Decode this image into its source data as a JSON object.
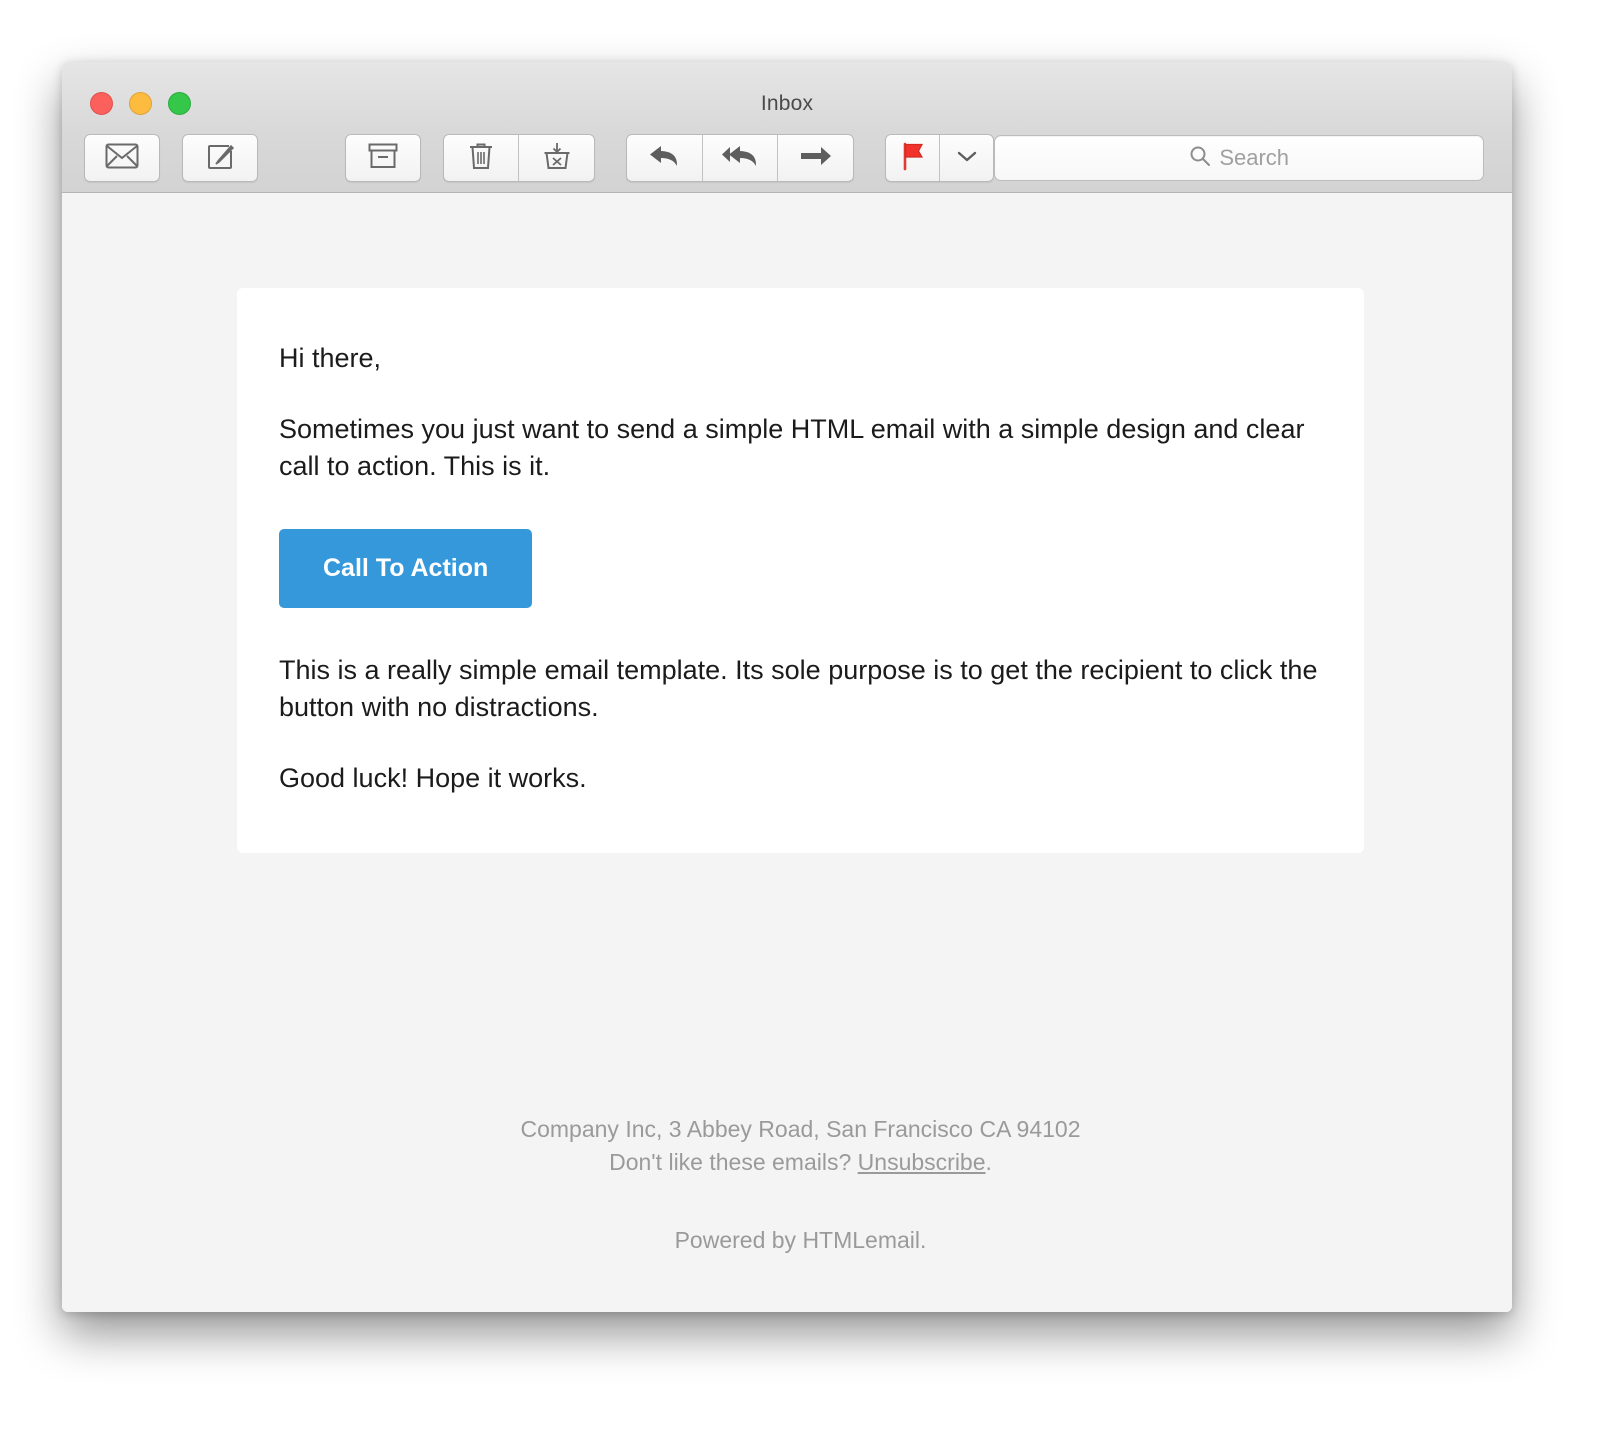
{
  "window": {
    "title": "Inbox",
    "traffic_lights": [
      {
        "name": "close",
        "color": "#fc605c"
      },
      {
        "name": "minimize",
        "color": "#fdbc40"
      },
      {
        "name": "maximize",
        "color": "#34c749"
      }
    ]
  },
  "toolbar": {
    "buttons": [
      {
        "name": "get-mail",
        "icon": "envelope-icon",
        "label": "Get Mail"
      },
      {
        "name": "compose",
        "icon": "compose-icon",
        "label": "Compose"
      },
      {
        "name": "archive",
        "icon": "archive-box-icon",
        "label": "Archive"
      },
      {
        "name": "delete",
        "icon": "trash-icon",
        "label": "Delete"
      },
      {
        "name": "junk",
        "icon": "junk-mail-icon",
        "label": "Junk"
      },
      {
        "name": "reply",
        "icon": "reply-arrow-icon",
        "label": "Reply"
      },
      {
        "name": "reply-all",
        "icon": "reply-all-arrow-icon",
        "label": "Reply All"
      },
      {
        "name": "forward",
        "icon": "forward-arrow-icon",
        "label": "Forward"
      },
      {
        "name": "flag",
        "icon": "red-flag-icon",
        "label": "Flag"
      },
      {
        "name": "flag-menu",
        "icon": "chevron-down-icon",
        "label": "Flag Options"
      }
    ]
  },
  "search": {
    "value": "",
    "placeholder": "Search",
    "icon": "search-icon"
  },
  "email": {
    "greeting": "Hi there,",
    "intro": "Sometimes you just want to send a simple HTML email with a simple design and clear call to action. This is it.",
    "cta_label": "Call To Action",
    "cta_color": "#3498db",
    "body": "This is a really simple email template. Its sole purpose is to get the recipient to click the button with no distractions.",
    "closing": "Good luck! Hope it works."
  },
  "footer": {
    "address": "Company Inc, 3 Abbey Road, San Francisco CA 94102",
    "unsubscribe_prefix": "Don't like these emails? ",
    "unsubscribe_label": "Unsubscribe",
    "unsubscribe_suffix": ".",
    "signature": "Powered by HTMLemail."
  }
}
